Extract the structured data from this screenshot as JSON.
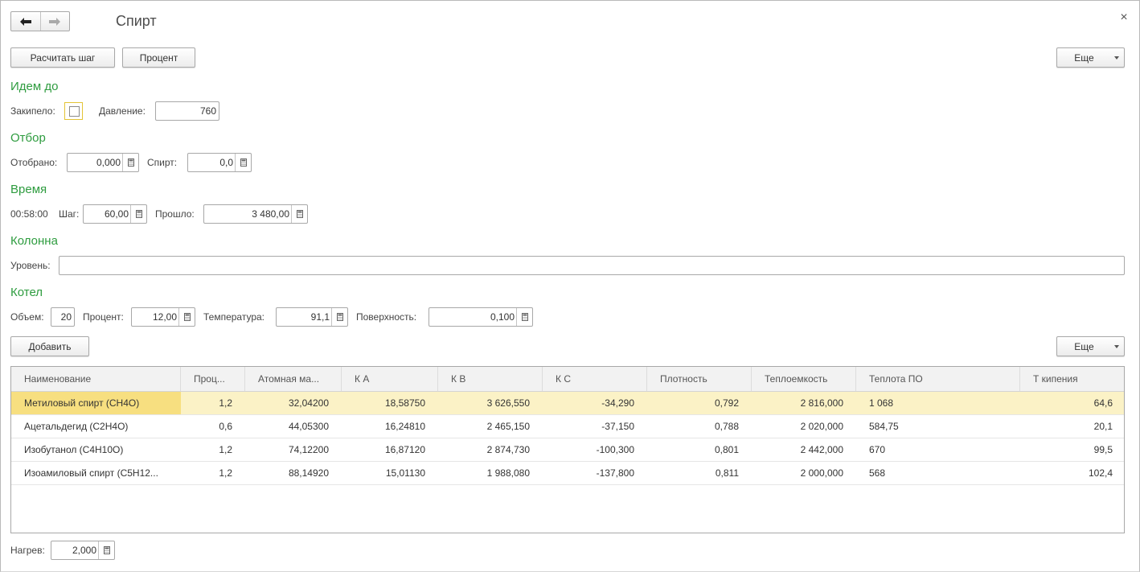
{
  "window": {
    "title": "Спирт",
    "close_glyph": "×",
    "nav_back_icon": "arrow-left-icon",
    "nav_forward_icon": "arrow-right-icon"
  },
  "toolbar": {
    "calc_step_label": "Расчитать шаг",
    "percent_label": "Процент",
    "more_label": "Еще"
  },
  "idem_do": {
    "heading": "Идем до",
    "boiled_label": "Закипело:",
    "boiled_checked": false,
    "pressure_label": "Давление:",
    "pressure_value": "760"
  },
  "otbor": {
    "heading": "Отбор",
    "taken_label": "Отобрано:",
    "taken_value": "0,000",
    "spirit_label": "Спирт:",
    "spirit_value": "0,0"
  },
  "vremya": {
    "heading": "Время",
    "clock": "00:58:00",
    "step_label": "Шаг:",
    "step_value": "60,00",
    "elapsed_label": "Прошло:",
    "elapsed_value": "3 480,00"
  },
  "kolonna": {
    "heading": "Колонна",
    "level_label": "Уровень:",
    "level_value": ""
  },
  "kotel": {
    "heading": "Котел",
    "volume_label": "Объем:",
    "volume_value": "20",
    "percent_label": "Процент:",
    "percent_value": "12,00",
    "temperature_label": "Температура:",
    "temperature_value": "91,1",
    "surface_label": "Поверхность:",
    "surface_value": "0,100"
  },
  "table_toolbar": {
    "add_label": "Добавить",
    "more_label": "Еще"
  },
  "table": {
    "columns": [
      "Наименование",
      "Проц...",
      "Атомная ма...",
      "К А",
      "К В",
      "К С",
      "Плотность",
      "Теплоемкость",
      "Теплота ПО",
      "Т кипения"
    ],
    "rows": [
      [
        "Метиловый спирт (CH4O)",
        "1,2",
        "32,04200",
        "18,58750",
        "3 626,550",
        "-34,290",
        "0,792",
        "2 816,000",
        "1 068",
        "64,6"
      ],
      [
        "Ацетальдегид (C2H4O)",
        "0,6",
        "44,05300",
        "16,24810",
        "2 465,150",
        "-37,150",
        "0,788",
        "2 020,000",
        "584,75",
        "20,1"
      ],
      [
        "Изобутанол (C4H10O)",
        "1,2",
        "74,12200",
        "16,87120",
        "2 874,730",
        "-100,300",
        "0,801",
        "2 442,000",
        "670",
        "99,5"
      ],
      [
        "Изоамиловый спирт (C5H12...",
        "1,2",
        "88,14920",
        "15,01130",
        "1 988,080",
        "-137,800",
        "0,811",
        "2 000,000",
        "568",
        "102,4"
      ]
    ],
    "selected_row": 0
  },
  "footer": {
    "heat_label": "Нагрев:",
    "heat_value": "2,000"
  },
  "colors": {
    "section_heading": "#2e9c3f",
    "selected_row": "#fbf2c6",
    "selected_cell": "#f7df80",
    "checkbox_focus": "#e3c436"
  }
}
